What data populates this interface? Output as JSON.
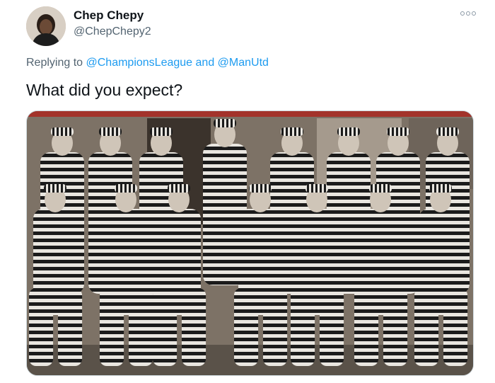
{
  "tweet": {
    "author": {
      "display_name": "Chep Chepy",
      "handle": "@ChepChepy2",
      "avatar_icon": "profile-photo"
    },
    "replying": {
      "prefix": "Replying to",
      "mention_1": "@ChampionsLeague",
      "conjunction": "and",
      "mention_2": "@ManUtd"
    },
    "text": "What did you expect?",
    "more_icon": "more-dots-icon",
    "media": {
      "kind": "photo",
      "colors": {
        "stripe_dark": "#1b1b1b",
        "stripe_light": "#e9e6e0",
        "background": "#7d7266"
      }
    },
    "colors": {
      "link": "#1d9bf0",
      "secondary": "#536471",
      "text": "#0f1419"
    }
  }
}
